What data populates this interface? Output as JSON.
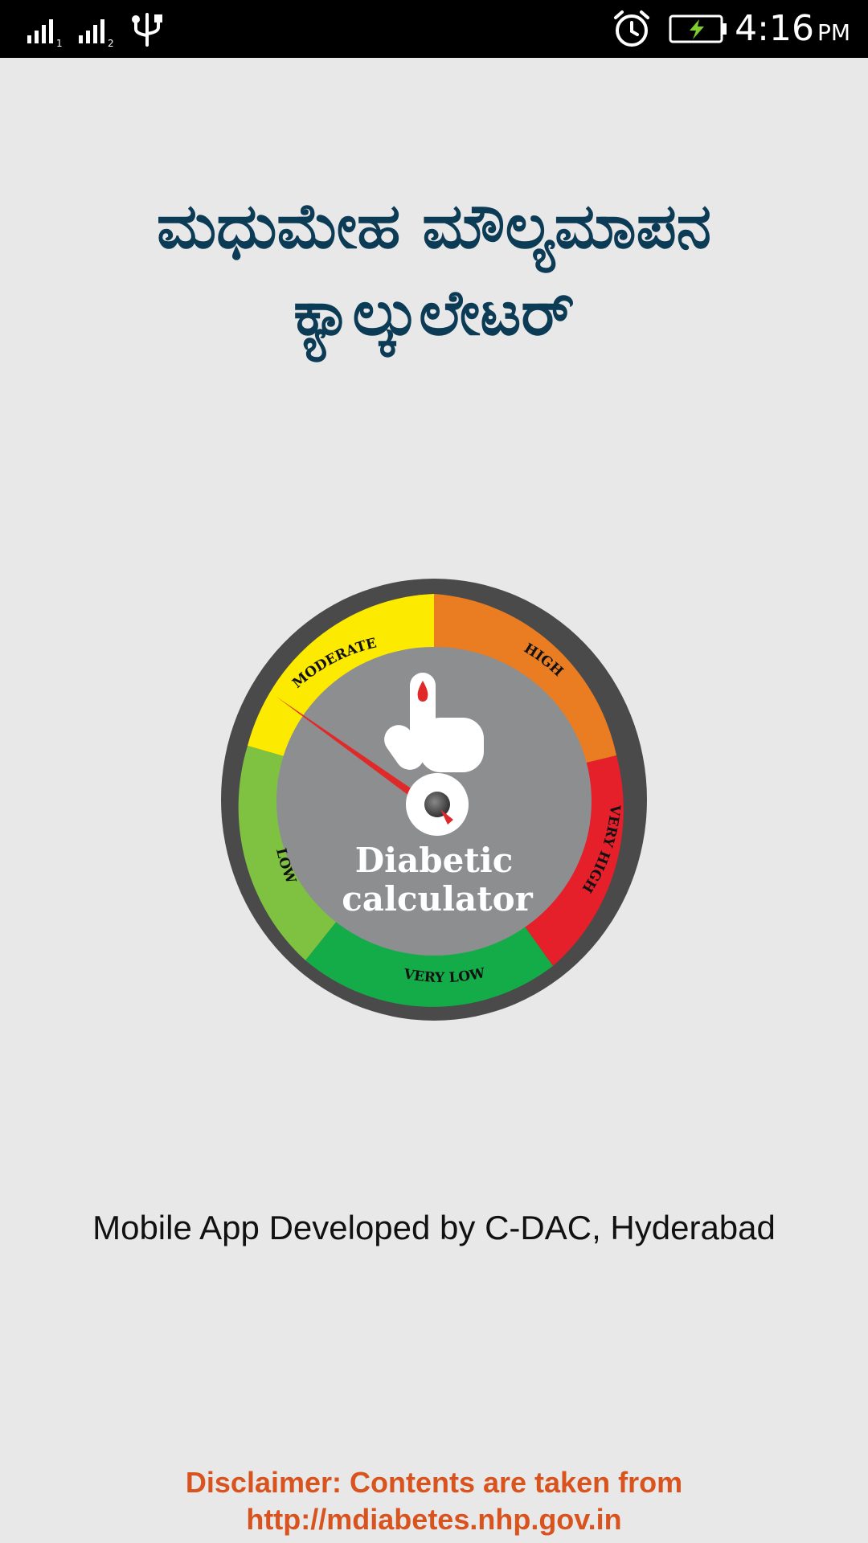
{
  "status_bar": {
    "signal1_label": "1",
    "signal2_label": "2",
    "time": "4:16",
    "ampm": "PM",
    "icons": [
      "signal-sim1-icon",
      "signal-sim2-icon",
      "usb-icon",
      "alarm-icon",
      "battery-charging-icon"
    ]
  },
  "app": {
    "title_line1": "ಮಧುಮೇಹ ಮೌಲ್ಯಮಾಪನ",
    "title_line2": "ಕ್ಯಾಲ್ಕುಲೇಟರ್",
    "logo": {
      "line1": "Diabetic",
      "line2": "calculator",
      "zones": {
        "moderate": "MODERATE",
        "high": "HIGH",
        "very_high": "VERY HIGH",
        "very_low": "VERY LOW",
        "low": "LOW"
      },
      "colors": {
        "moderate": "#fcea00",
        "high": "#ea7d22",
        "very_high": "#e5202b",
        "very_low": "#14ac48",
        "low": "#7fc241",
        "rim": "#4a4a4a",
        "center": "#8d8e90",
        "needle": "#e02a2a"
      }
    },
    "credit": "Mobile App Developed by C-DAC, Hyderabad",
    "disclaimer_line1": "Disclaimer: Contents are taken from",
    "disclaimer_line2": "http://mdiabetes.nhp.gov.in"
  },
  "colors": {
    "title": "#0c3b56",
    "disclaimer": "#d9531e",
    "background": "#e8e8e8"
  }
}
